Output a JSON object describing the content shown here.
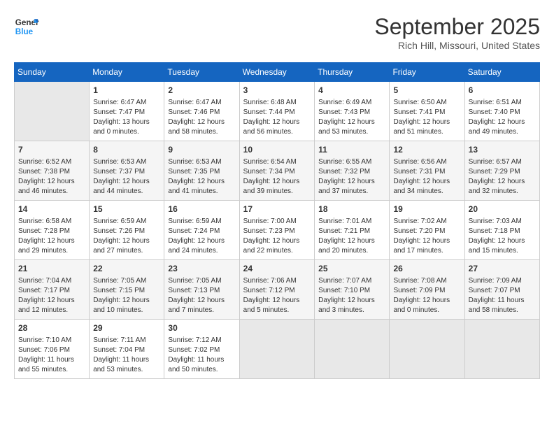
{
  "header": {
    "logo_line1": "General",
    "logo_line2": "Blue",
    "month": "September 2025",
    "location": "Rich Hill, Missouri, United States"
  },
  "weekdays": [
    "Sunday",
    "Monday",
    "Tuesday",
    "Wednesday",
    "Thursday",
    "Friday",
    "Saturday"
  ],
  "weeks": [
    [
      {
        "day": "",
        "info": ""
      },
      {
        "day": "1",
        "info": "Sunrise: 6:47 AM\nSunset: 7:47 PM\nDaylight: 13 hours\nand 0 minutes."
      },
      {
        "day": "2",
        "info": "Sunrise: 6:47 AM\nSunset: 7:46 PM\nDaylight: 12 hours\nand 58 minutes."
      },
      {
        "day": "3",
        "info": "Sunrise: 6:48 AM\nSunset: 7:44 PM\nDaylight: 12 hours\nand 56 minutes."
      },
      {
        "day": "4",
        "info": "Sunrise: 6:49 AM\nSunset: 7:43 PM\nDaylight: 12 hours\nand 53 minutes."
      },
      {
        "day": "5",
        "info": "Sunrise: 6:50 AM\nSunset: 7:41 PM\nDaylight: 12 hours\nand 51 minutes."
      },
      {
        "day": "6",
        "info": "Sunrise: 6:51 AM\nSunset: 7:40 PM\nDaylight: 12 hours\nand 49 minutes."
      }
    ],
    [
      {
        "day": "7",
        "info": "Sunrise: 6:52 AM\nSunset: 7:38 PM\nDaylight: 12 hours\nand 46 minutes."
      },
      {
        "day": "8",
        "info": "Sunrise: 6:53 AM\nSunset: 7:37 PM\nDaylight: 12 hours\nand 44 minutes."
      },
      {
        "day": "9",
        "info": "Sunrise: 6:53 AM\nSunset: 7:35 PM\nDaylight: 12 hours\nand 41 minutes."
      },
      {
        "day": "10",
        "info": "Sunrise: 6:54 AM\nSunset: 7:34 PM\nDaylight: 12 hours\nand 39 minutes."
      },
      {
        "day": "11",
        "info": "Sunrise: 6:55 AM\nSunset: 7:32 PM\nDaylight: 12 hours\nand 37 minutes."
      },
      {
        "day": "12",
        "info": "Sunrise: 6:56 AM\nSunset: 7:31 PM\nDaylight: 12 hours\nand 34 minutes."
      },
      {
        "day": "13",
        "info": "Sunrise: 6:57 AM\nSunset: 7:29 PM\nDaylight: 12 hours\nand 32 minutes."
      }
    ],
    [
      {
        "day": "14",
        "info": "Sunrise: 6:58 AM\nSunset: 7:28 PM\nDaylight: 12 hours\nand 29 minutes."
      },
      {
        "day": "15",
        "info": "Sunrise: 6:59 AM\nSunset: 7:26 PM\nDaylight: 12 hours\nand 27 minutes."
      },
      {
        "day": "16",
        "info": "Sunrise: 6:59 AM\nSunset: 7:24 PM\nDaylight: 12 hours\nand 24 minutes."
      },
      {
        "day": "17",
        "info": "Sunrise: 7:00 AM\nSunset: 7:23 PM\nDaylight: 12 hours\nand 22 minutes."
      },
      {
        "day": "18",
        "info": "Sunrise: 7:01 AM\nSunset: 7:21 PM\nDaylight: 12 hours\nand 20 minutes."
      },
      {
        "day": "19",
        "info": "Sunrise: 7:02 AM\nSunset: 7:20 PM\nDaylight: 12 hours\nand 17 minutes."
      },
      {
        "day": "20",
        "info": "Sunrise: 7:03 AM\nSunset: 7:18 PM\nDaylight: 12 hours\nand 15 minutes."
      }
    ],
    [
      {
        "day": "21",
        "info": "Sunrise: 7:04 AM\nSunset: 7:17 PM\nDaylight: 12 hours\nand 12 minutes."
      },
      {
        "day": "22",
        "info": "Sunrise: 7:05 AM\nSunset: 7:15 PM\nDaylight: 12 hours\nand 10 minutes."
      },
      {
        "day": "23",
        "info": "Sunrise: 7:05 AM\nSunset: 7:13 PM\nDaylight: 12 hours\nand 7 minutes."
      },
      {
        "day": "24",
        "info": "Sunrise: 7:06 AM\nSunset: 7:12 PM\nDaylight: 12 hours\nand 5 minutes."
      },
      {
        "day": "25",
        "info": "Sunrise: 7:07 AM\nSunset: 7:10 PM\nDaylight: 12 hours\nand 3 minutes."
      },
      {
        "day": "26",
        "info": "Sunrise: 7:08 AM\nSunset: 7:09 PM\nDaylight: 12 hours\nand 0 minutes."
      },
      {
        "day": "27",
        "info": "Sunrise: 7:09 AM\nSunset: 7:07 PM\nDaylight: 11 hours\nand 58 minutes."
      }
    ],
    [
      {
        "day": "28",
        "info": "Sunrise: 7:10 AM\nSunset: 7:06 PM\nDaylight: 11 hours\nand 55 minutes."
      },
      {
        "day": "29",
        "info": "Sunrise: 7:11 AM\nSunset: 7:04 PM\nDaylight: 11 hours\nand 53 minutes."
      },
      {
        "day": "30",
        "info": "Sunrise: 7:12 AM\nSunset: 7:02 PM\nDaylight: 11 hours\nand 50 minutes."
      },
      {
        "day": "",
        "info": ""
      },
      {
        "day": "",
        "info": ""
      },
      {
        "day": "",
        "info": ""
      },
      {
        "day": "",
        "info": ""
      }
    ]
  ]
}
